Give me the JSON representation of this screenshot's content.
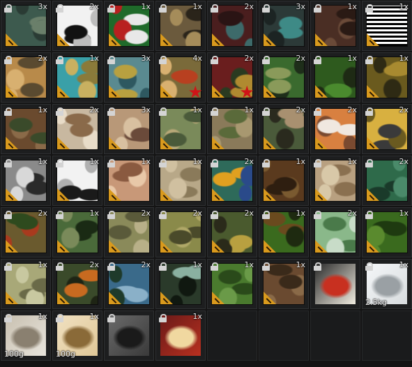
{
  "colors": {
    "tag": "#d99a1d",
    "star": "#d01418",
    "lock": "#d4d4d4"
  },
  "slots": [
    {
      "qty": "3x",
      "icon": "camo-skin-icon",
      "pattern": [
        "#3d5a4e",
        "#6a7f6a",
        "#2a3b34"
      ]
    },
    {
      "qty": "2x",
      "icon": "zebra-camo-icon",
      "pattern": [
        "#f2f2f2",
        "#111111",
        "#bdbdbd"
      ]
    },
    {
      "qty": "1x",
      "icon": "floral-camo-icon",
      "pattern": [
        "#1f6a2a",
        "#e8e8e8",
        "#b82020"
      ]
    },
    {
      "qty": "1x",
      "icon": "tiger-camo-icon",
      "pattern": [
        "#6b5a3d",
        "#2a241a",
        "#a58c5a"
      ]
    },
    {
      "qty": "2x",
      "icon": "dark-red-camo-icon",
      "pattern": [
        "#4a1e1e",
        "#2a1414",
        "#3d6a6a"
      ]
    },
    {
      "qty": "3x",
      "icon": "teal-star-camo-icon",
      "pattern": [
        "#2c3a38",
        "#3e8a86",
        "#1c2423"
      ]
    },
    {
      "qty": "1x",
      "icon": "brown-camo-icon",
      "pattern": [
        "#4a2e24",
        "#2a1a14",
        "#6a4a38"
      ]
    },
    {
      "qty": "1x",
      "icon": "qr-code-icon",
      "pattern": [
        "#ffffff",
        "#000000",
        "#ffffff"
      ],
      "qr": true
    },
    {
      "qty": "2x",
      "icon": "desert-camo-icon",
      "pattern": [
        "#b88a4a",
        "#5a4a30",
        "#d8b070"
      ]
    },
    {
      "qty": "1x",
      "icon": "aqua-camo-icon",
      "pattern": [
        "#3aa0a8",
        "#8a7a3a",
        "#c8b060"
      ]
    },
    {
      "qty": "3x",
      "icon": "leaf-camo-icon",
      "pattern": [
        "#5a8a90",
        "#b8a040",
        "#2e5860"
      ]
    },
    {
      "qty": "4x",
      "icon": "red-star-camo-icon",
      "pattern": [
        "#7a6a3a",
        "#b84020",
        "#d8b070"
      ],
      "star": true
    },
    {
      "qty": "2x",
      "icon": "confetti-camo-icon",
      "pattern": [
        "#6a1e1e",
        "#b08a30",
        "#2a3a20"
      ],
      "star": true
    },
    {
      "qty": "2x",
      "icon": "flecktarn-camo-icon",
      "pattern": [
        "#3a6a2e",
        "#8a9a5a",
        "#1e2e1a"
      ]
    },
    {
      "qty": "1x",
      "icon": "woodland-camo-icon",
      "pattern": [
        "#2e5a1e",
        "#4a8a2e",
        "#1e2a14"
      ]
    },
    {
      "qty": "1x",
      "icon": "olive-camo-icon",
      "pattern": [
        "#6a5a1e",
        "#a88a30",
        "#2e2a14"
      ]
    },
    {
      "qty": "1x",
      "icon": "woodland-brown-camo-icon",
      "pattern": [
        "#6a4a2e",
        "#3a4a2a",
        "#8a6a48"
      ]
    },
    {
      "qty": "2x",
      "icon": "light-desert-camo-icon",
      "pattern": [
        "#c8b8a0",
        "#8a6a4a",
        "#e8dcc8"
      ]
    },
    {
      "qty": "3x",
      "icon": "tan-camo-icon",
      "pattern": [
        "#b89878",
        "#6a4a3a",
        "#d8c0a0"
      ]
    },
    {
      "qty": "1x",
      "icon": "green-tan-camo-icon",
      "pattern": [
        "#7a8a5a",
        "#4a5a3a",
        "#b8a878"
      ]
    },
    {
      "qty": "1x",
      "icon": "khaki-camo-icon",
      "pattern": [
        "#8a7a5a",
        "#5a6a3a",
        "#a89870"
      ]
    },
    {
      "qty": "2x",
      "icon": "mixed-camo-icon",
      "pattern": [
        "#4a5a3a",
        "#a89070",
        "#2a2a1e"
      ]
    },
    {
      "qty": "2x",
      "icon": "orange-camo-icon",
      "pattern": [
        "#d88040",
        "#f0e8e0",
        "#7a4a30"
      ]
    },
    {
      "qty": "2x",
      "icon": "yellow-camo-icon",
      "pattern": [
        "#d8b040",
        "#3a3a3a",
        "#6a5a20"
      ]
    },
    {
      "qty": "1x",
      "icon": "urban-camo-icon",
      "pattern": [
        "#8a8a8a",
        "#2a2a2a",
        "#d8d8d8"
      ]
    },
    {
      "qty": "1x",
      "icon": "arctic-camo-icon",
      "pattern": [
        "#f2f2f2",
        "#1a1a1a",
        "#b0b0b0"
      ]
    },
    {
      "qty": "1x",
      "icon": "sand-camo-icon",
      "pattern": [
        "#c89878",
        "#8a5a40",
        "#e8c8a8"
      ]
    },
    {
      "qty": "1x",
      "icon": "beige-camo-icon",
      "pattern": [
        "#b8a888",
        "#8a7a5a",
        "#d0c0a0"
      ]
    },
    {
      "qty": "2x",
      "icon": "blue-camo-icon",
      "pattern": [
        "#2e6a5a",
        "#e0a020",
        "#2a4a8a"
      ]
    },
    {
      "qty": "1x",
      "icon": "dark-brown-camo-icon",
      "pattern": [
        "#5a3a1e",
        "#2e1e10",
        "#7a5a30"
      ]
    },
    {
      "qty": "1x",
      "icon": "light-beige-camo-icon",
      "pattern": [
        "#b8a080",
        "#8a7050",
        "#d8c8a8"
      ]
    },
    {
      "qty": "2x",
      "icon": "teal-green-camo-icon",
      "pattern": [
        "#2e6a4a",
        "#1a3a2a",
        "#4a8a6a"
      ]
    },
    {
      "qty": "2x",
      "icon": "jungle-camo-icon",
      "pattern": [
        "#6a5a2e",
        "#2e4a1e",
        "#a83a1e"
      ]
    },
    {
      "qty": "1x",
      "icon": "tigerstripe-camo-icon",
      "pattern": [
        "#4a6a3a",
        "#1a2a14",
        "#7a8a5a"
      ]
    },
    {
      "qty": "2x",
      "icon": "pale-camo-icon",
      "pattern": [
        "#8a8a5a",
        "#5a5a3a",
        "#b8b088"
      ]
    },
    {
      "qty": "2x",
      "icon": "olive-spots-camo-icon",
      "pattern": [
        "#8a8a4a",
        "#4a4a2a",
        "#b0a868"
      ]
    },
    {
      "qty": "2x",
      "icon": "dot-camo-icon",
      "pattern": [
        "#4a5a2e",
        "#b8a040",
        "#2a2a1a"
      ]
    },
    {
      "qty": "1x",
      "icon": "forest-camo-icon",
      "pattern": [
        "#3a6a1e",
        "#6a4a1e",
        "#1e2a10"
      ]
    },
    {
      "qty": "2x",
      "icon": "light-green-camo-icon",
      "pattern": [
        "#8ab88a",
        "#4a7a4a",
        "#c8dcc8"
      ]
    },
    {
      "qty": "1x",
      "icon": "deep-green-camo-icon",
      "pattern": [
        "#3a6a1e",
        "#1e3a10",
        "#5a8a2e"
      ]
    },
    {
      "qty": "1x",
      "icon": "digital-tan-camo-icon",
      "pattern": [
        "#a8a878",
        "#6a6a48",
        "#c8c8a0"
      ]
    },
    {
      "qty": "2x",
      "icon": "digital-orange-camo-icon",
      "pattern": [
        "#3a4a2a",
        "#c86a20",
        "#1e2414"
      ]
    },
    {
      "qty": "2x",
      "icon": "digital-blue-camo-icon",
      "pattern": [
        "#3a6a8a",
        "#8ab0c8",
        "#1e3a2a"
      ]
    },
    {
      "qty": "1x",
      "icon": "digital-night-camo-icon",
      "pattern": [
        "#2a3a2a",
        "#8ab0a0",
        "#101810"
      ]
    },
    {
      "qty": "1x",
      "icon": "woodland-green-camo-icon",
      "pattern": [
        "#4a7a2e",
        "#2a4a1a",
        "#6a9a48"
      ]
    },
    {
      "qty": "1x",
      "icon": "rust-camo-icon",
      "pattern": [
        "#6a4a30",
        "#3a2a1a",
        "#8a6a48"
      ]
    },
    {
      "qty": "",
      "icon": "poster-icon",
      "photo": [
        "#f0ece0",
        "#c83020",
        "#2a2a2a"
      ]
    },
    {
      "qty": "1x",
      "icon": "briefcase-icon",
      "weight": "2.5kg",
      "photo": [
        "#d8dcde",
        "#9aa0a4",
        "#f4f6f8"
      ]
    },
    {
      "qty": "1x",
      "icon": "paper-bag-icon",
      "weight": "100g",
      "photo": [
        "#e8e4dc",
        "#8a8070",
        "#c8c0b0"
      ]
    },
    {
      "qty": "1x",
      "icon": "ration-pack-icon",
      "weight": "100g",
      "photo": [
        "#e0c898",
        "#8a6a38",
        "#f0e0c0"
      ]
    },
    {
      "qty": "",
      "icon": "photograph-icon",
      "photo": [
        "#3a3a3a",
        "#1a1a1a",
        "#6a6a6a"
      ]
    },
    {
      "qty": "1x",
      "icon": "magazine-icon",
      "photo": [
        "#b83020",
        "#f0d8a0",
        "#6a1a18"
      ]
    },
    null,
    null,
    null,
    null
  ]
}
